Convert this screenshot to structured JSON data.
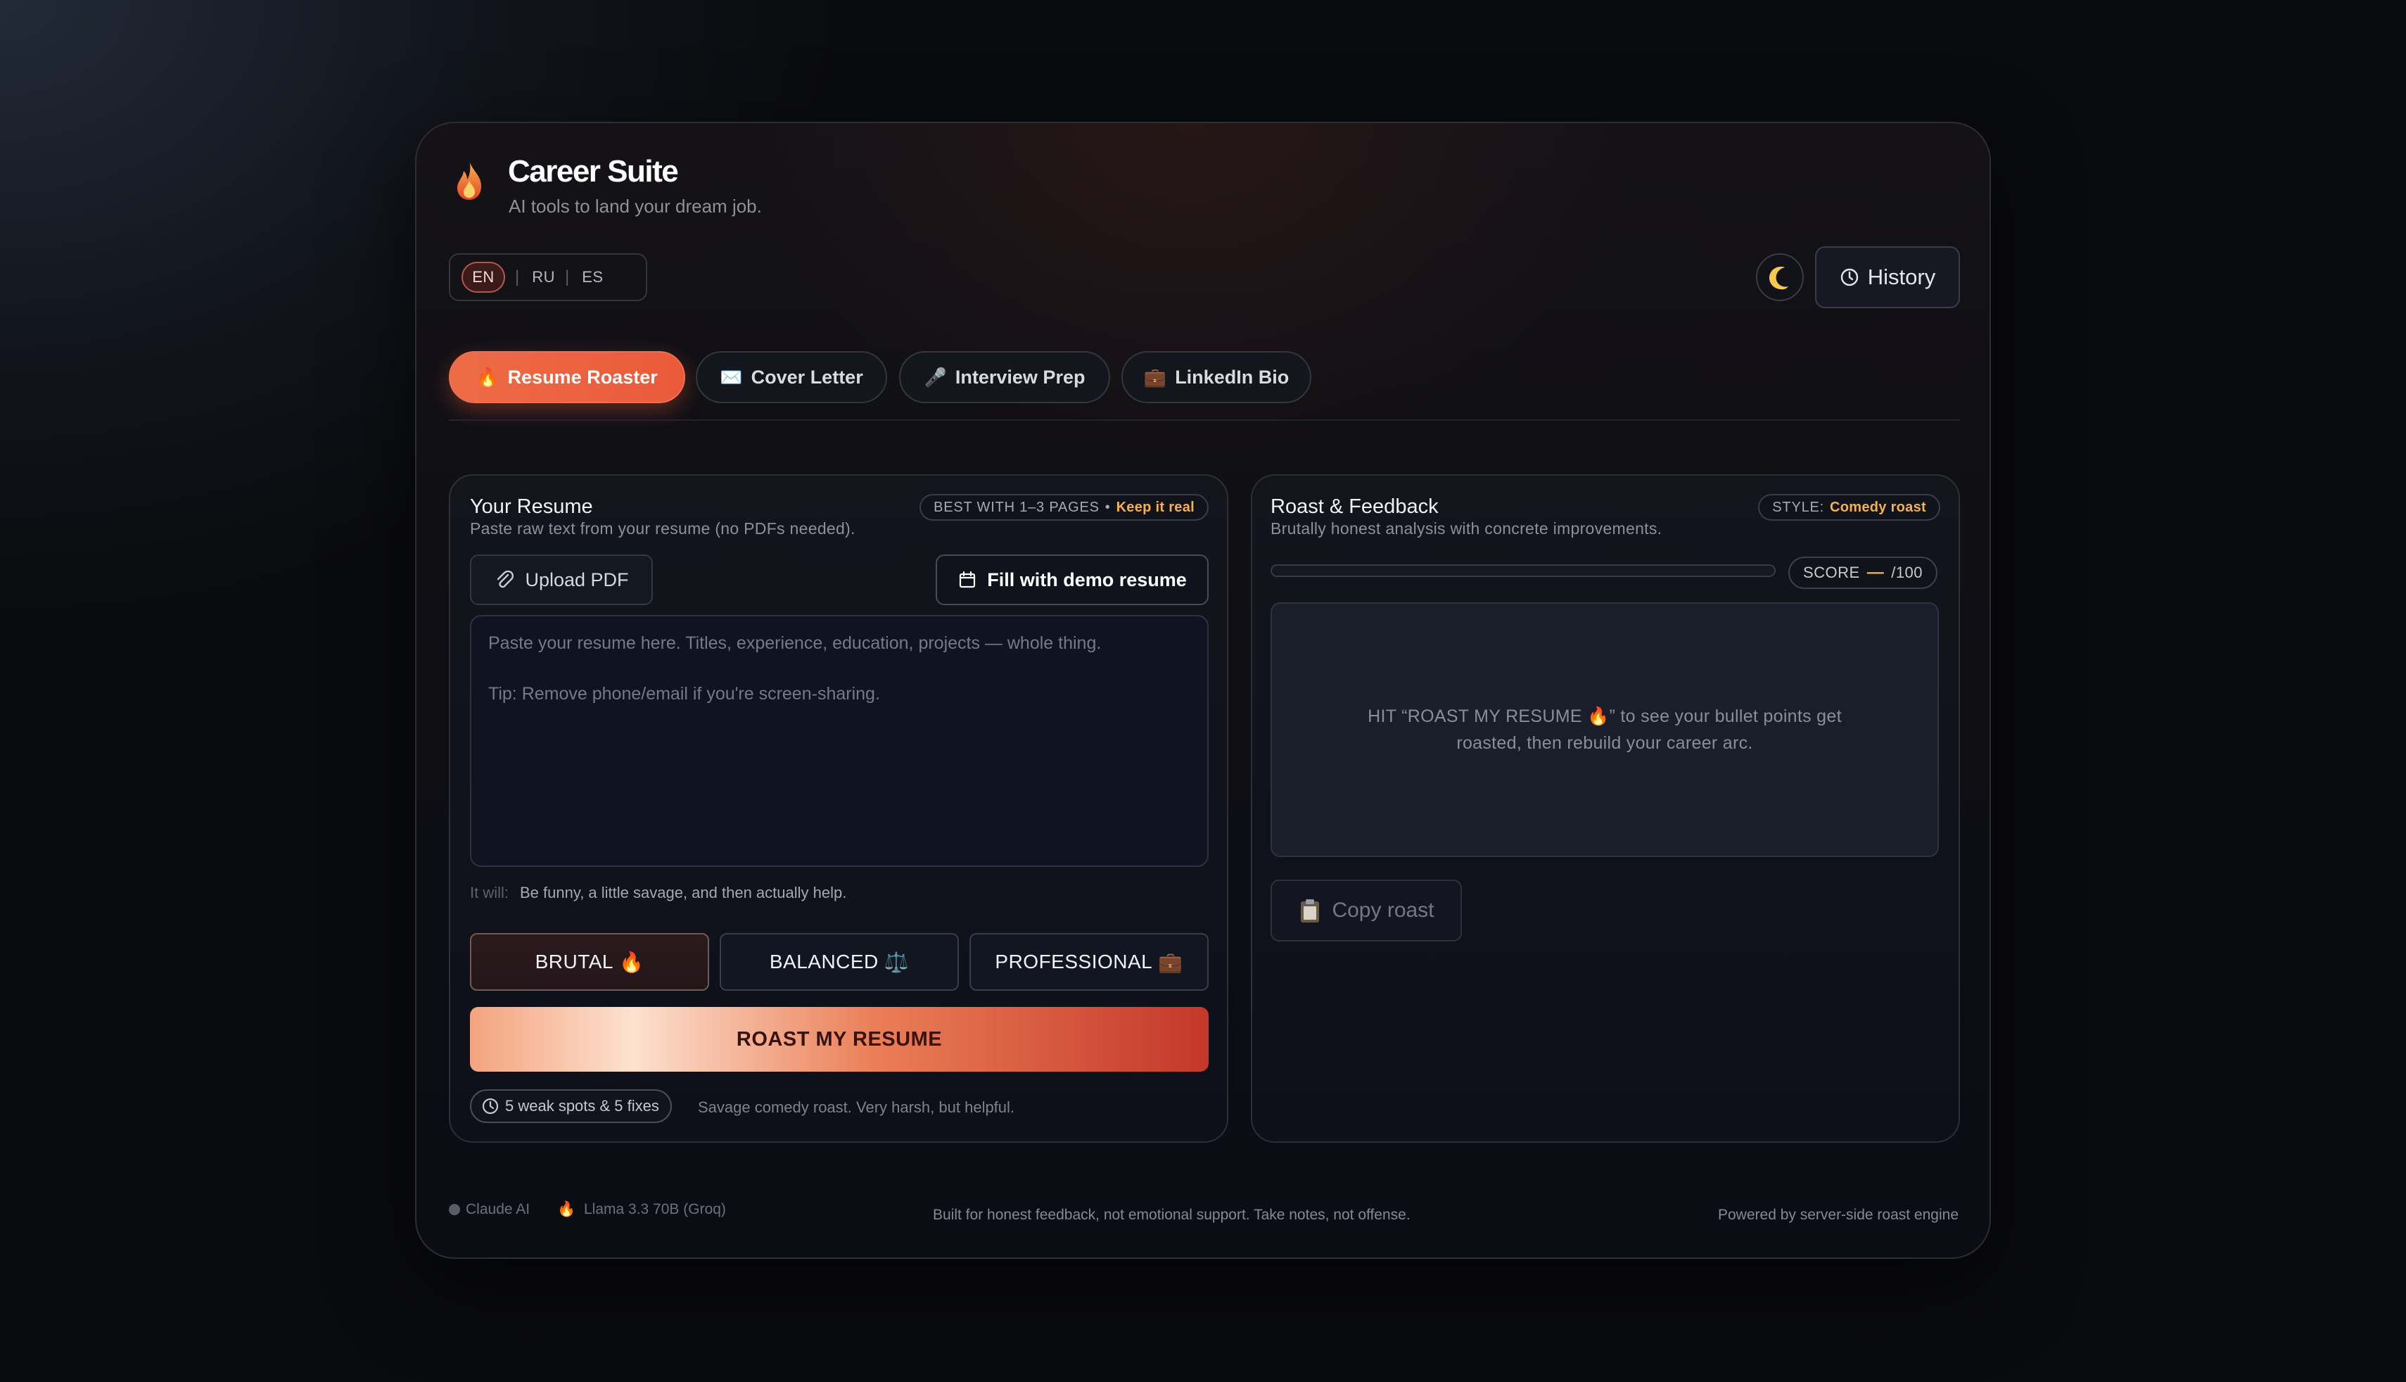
{
  "header": {
    "title": "Career Suite",
    "subtitle": "AI tools to land your dream job."
  },
  "languages": [
    {
      "code": "EN",
      "active": true
    },
    {
      "code": "RU",
      "active": false
    },
    {
      "code": "ES",
      "active": false
    }
  ],
  "toolbar": {
    "theme_icon": "moon-icon",
    "history_label": "History"
  },
  "tabs": [
    {
      "icon": "🔥",
      "label": "Resume Roaster",
      "active": true
    },
    {
      "icon": "✉️",
      "label": "Cover Letter",
      "active": false
    },
    {
      "icon": "🎤",
      "label": "Interview Prep",
      "active": false
    },
    {
      "icon": "💼",
      "label": "LinkedIn Bio",
      "active": false
    }
  ],
  "resume_panel": {
    "title": "Your Resume",
    "subtitle": "Paste raw text from your resume (no PDFs needed).",
    "chip_text": "BEST WITH 1–3 PAGES",
    "chip_sep": "•",
    "chip_accent": "Keep it real",
    "upload_label": "Upload PDF",
    "demo_label": "Fill with demo resume",
    "placeholder_line1": "Paste your resume here. Titles, experience, education, projects — whole thing.",
    "placeholder_line2": "Tip: Remove phone/email if you're screen-sharing.",
    "it_will_label": "It will:",
    "it_will_text": "Be funny, a little savage, and then actually help.",
    "modes": [
      {
        "label": "BRUTAL",
        "icon": "🔥",
        "active": true
      },
      {
        "label": "BALANCED",
        "icon": "⚖️",
        "active": false
      },
      {
        "label": "PROFESSIONAL",
        "icon": "💼",
        "active": false
      }
    ],
    "roast_button": "ROAST MY RESUME",
    "badge_text": "5 weak spots & 5 fixes",
    "note": "Savage comedy roast. Very harsh, but helpful."
  },
  "feedback_panel": {
    "title": "Roast & Feedback",
    "subtitle": "Brutally honest analysis with concrete improvements.",
    "style_label": "STYLE:",
    "style_value": "Comedy roast",
    "score_label": "SCORE",
    "score_value": "—",
    "score_max": "/100",
    "empty_message": "HIT “ROAST MY RESUME 🔥” to see your bullet points get roasted, then rebuild your career arc.",
    "copy_label": "Copy roast"
  },
  "footer": {
    "provider1": "Claude AI",
    "provider2_icon": "🔥",
    "provider2": "Llama 3.3 70B (Groq)",
    "center": "Built for honest feedback, not emotional support. Take notes, not offense.",
    "right": "Powered by server-side roast engine"
  },
  "colors": {
    "accent": "#ea5a3a",
    "highlight": "#f4b14e",
    "background": "#0a0b0e"
  }
}
